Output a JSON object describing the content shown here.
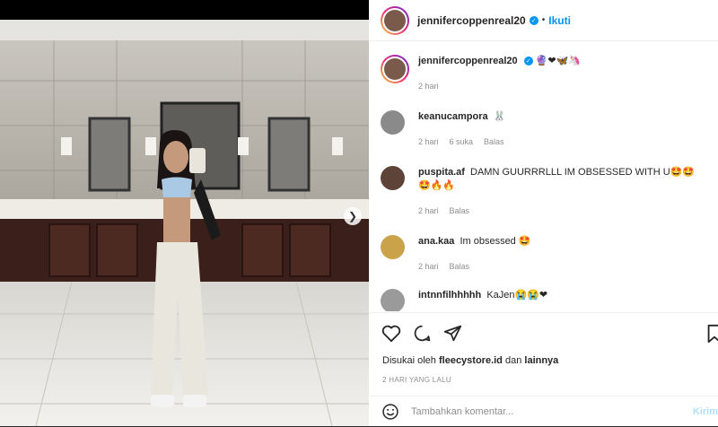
{
  "post": {
    "username": "jennifercoppenreal20",
    "follow_label": "Ikuti",
    "dot": "•",
    "caption_emojis": "🔮❤🦋🦄",
    "caption_time": "2 hari"
  },
  "comments": [
    {
      "user": "keanucampora",
      "text": "🐰",
      "time": "2 hari",
      "likes": "6 suka",
      "reply": "Balas"
    },
    {
      "user": "puspita.af",
      "text": "DAMN GUURRRLLL IM OBSESSED WITH U🤩🤩🤩🔥🔥",
      "time": "2 hari",
      "likes": "",
      "reply": "Balas"
    },
    {
      "user": "ana.kaa",
      "text": "Im obsessed 🤩",
      "time": "2 hari",
      "likes": "",
      "reply": "Balas"
    },
    {
      "user": "intnnfilhhhhh",
      "text": "KaJen😭😭❤",
      "time": "",
      "likes": "",
      "reply": ""
    }
  ],
  "footer": {
    "liked_prefix": "Disukai oleh",
    "liked_user": "fleecystore.id",
    "liked_and": "dan",
    "liked_others": "lainnya",
    "timestamp": "2 HARI YANG LALU",
    "comment_placeholder": "Tambahkan komentar...",
    "post_label": "Kirim"
  },
  "colors": {
    "accent": "#0095f6",
    "text": "#262626",
    "muted": "#8e8e8e"
  },
  "icons": [
    "heart-icon",
    "comment-icon",
    "share-icon",
    "bookmark-icon",
    "emoji-icon",
    "verified-icon",
    "chevron-right-icon"
  ]
}
